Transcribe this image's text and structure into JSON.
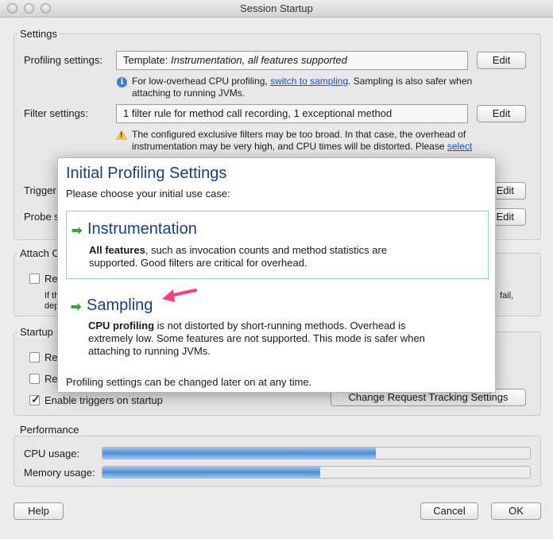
{
  "window": {
    "title": "Session Startup"
  },
  "settings": {
    "group_title": "Settings",
    "profiling": {
      "label": "Profiling settings:",
      "value_prefix": "Template: ",
      "value_italic": "Instrumentation, all features supported",
      "edit": "Edit",
      "note_before": "For low-overhead CPU profiling, ",
      "note_link": "switch to sampling",
      "note_after": ". Sampling is also safer when",
      "note_line2": "attaching to running JVMs."
    },
    "filter": {
      "label": "Filter settings:",
      "value": "1 filter rule for method call recording, 1 exceptional method",
      "edit": "Edit",
      "warn_line1": "The configured exclusive filters may be too broad. In that case, the overhead of",
      "warn_line2_before": "instrumentation may be very high, and CPU times will be distorted. Please ",
      "warn_link": "select"
    },
    "trigger": {
      "label": "Trigger",
      "edit": "Edit"
    },
    "probe": {
      "label": "Probe s",
      "edit": "Edit"
    }
  },
  "attach": {
    "group_title": "Attach O",
    "checkbox_label": "Re",
    "note_a": "If th",
    "note_b": "dep",
    "note_fail": "fail,"
  },
  "startup": {
    "group_title": "Startup",
    "check1": "Re",
    "check2": "Re",
    "check3": "Enable triggers on startup",
    "check3_checked": true,
    "tracking_button": "Change Request Tracking Settings"
  },
  "performance": {
    "group_title": "Performance",
    "cpu_label": "CPU usage:",
    "memory_label": "Memory usage:",
    "cpu_level": 0.64,
    "memory_level": 0.51
  },
  "footer": {
    "help": "Help",
    "cancel": "Cancel",
    "ok": "OK"
  },
  "popup": {
    "title": "Initial Profiling Settings",
    "subtitle": "Please choose your initial use case:",
    "options": [
      {
        "title": "Instrumentation",
        "desc_bold": "All features",
        "desc_rest": ", such as invocation counts and method statistics are",
        "desc_line2": "supported. Good filters are critical for overhead."
      },
      {
        "title": "Sampling",
        "desc_bold": "CPU profiling",
        "desc_rest": " is not distorted by short-running methods. Overhead is",
        "desc_line2": "extremely low. Some features are not supported. This mode is safer when",
        "desc_line3": "attaching to running JVMs."
      }
    ],
    "footer": "Profiling settings can be changed later on at any time."
  },
  "colors": {
    "accent_blue": "#173f8a",
    "link": "#1f4fc8",
    "pointer": "#ff3d7f",
    "arrow": "#3aa63a"
  }
}
